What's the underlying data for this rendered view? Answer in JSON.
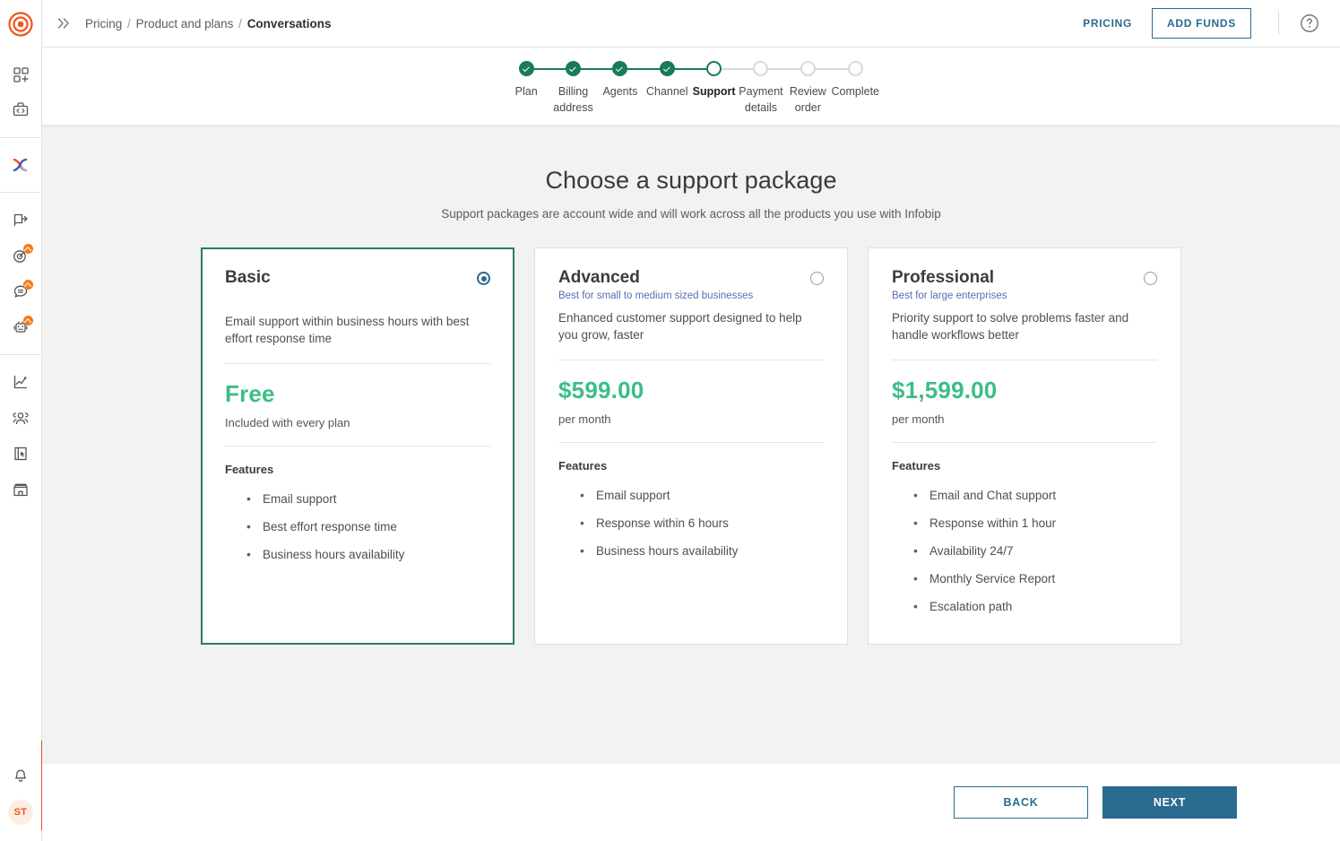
{
  "brand": {
    "logo_icon": "infobip-target-logo",
    "accent_orange": "#f0531c",
    "accent_teal": "#2a6b8f",
    "accent_green": "#1a7a5e",
    "price_green": "#3dbd84"
  },
  "sidebar": {
    "expand_icon": "chevron-double-right-icon",
    "groups": [
      {
        "items": [
          {
            "name": "apps-add-icon",
            "label": ""
          },
          {
            "name": "developer-tools-icon",
            "label": ""
          }
        ]
      },
      {
        "items": [
          {
            "name": "conversations-icon",
            "label": "",
            "active": true
          }
        ]
      },
      {
        "items": [
          {
            "name": "broadcast-icon",
            "label": ""
          },
          {
            "name": "moments-target-icon",
            "label": "",
            "badge": true
          },
          {
            "name": "chat-icon",
            "label": "",
            "badge": true
          },
          {
            "name": "answers-bot-icon",
            "label": "",
            "badge": true
          }
        ]
      },
      {
        "items": [
          {
            "name": "analyze-chart-icon",
            "label": ""
          },
          {
            "name": "people-icon",
            "label": ""
          },
          {
            "name": "forms-icon",
            "label": ""
          },
          {
            "name": "storefront-icon",
            "label": ""
          }
        ]
      }
    ],
    "bottom": {
      "notifications_icon": "bell-icon",
      "avatar_initials": "ST"
    }
  },
  "header": {
    "breadcrumb": {
      "items": [
        "Pricing",
        "Product and plans"
      ],
      "current": "Conversations",
      "separator": "/"
    },
    "pricing_link": "PRICING",
    "add_funds_button": "ADD FUNDS",
    "help_icon": "question-mark-circle-icon"
  },
  "stepper": {
    "steps": [
      {
        "label": "Plan",
        "state": "done"
      },
      {
        "label": "Billing address",
        "state": "done"
      },
      {
        "label": "Agents",
        "state": "done"
      },
      {
        "label": "Channel",
        "state": "done"
      },
      {
        "label": "Support",
        "state": "current"
      },
      {
        "label": "Payment details",
        "state": "upcoming"
      },
      {
        "label": "Review order",
        "state": "upcoming"
      },
      {
        "label": "Complete",
        "state": "upcoming"
      }
    ]
  },
  "main": {
    "title": "Choose a support package",
    "subtitle": "Support packages are account wide and will work across all the products you use with Infobip",
    "features_heading": "Features",
    "packages": [
      {
        "name": "Basic",
        "best_for": "",
        "description": "Email support within business hours with best effort response time",
        "price": "Free",
        "price_sub": "Included with every plan",
        "selected": true,
        "features": [
          "Email support",
          "Best effort response time",
          "Business hours availability"
        ]
      },
      {
        "name": "Advanced",
        "best_for": "Best for small to medium sized businesses",
        "description": "Enhanced customer support designed to help you grow, faster",
        "price": "$599.00",
        "price_sub": "per month",
        "selected": false,
        "features": [
          "Email support",
          "Response within 6 hours",
          "Business hours availability"
        ]
      },
      {
        "name": "Professional",
        "best_for": "Best for large enterprises",
        "description": "Priority support to solve problems faster and handle workflows better",
        "price": "$1,599.00",
        "price_sub": "per month",
        "selected": false,
        "features": [
          "Email and Chat support",
          "Response within 1 hour",
          "Availability 24/7",
          "Monthly Service Report",
          "Escalation path"
        ]
      }
    ]
  },
  "footer": {
    "back_button": "BACK",
    "next_button": "NEXT"
  }
}
